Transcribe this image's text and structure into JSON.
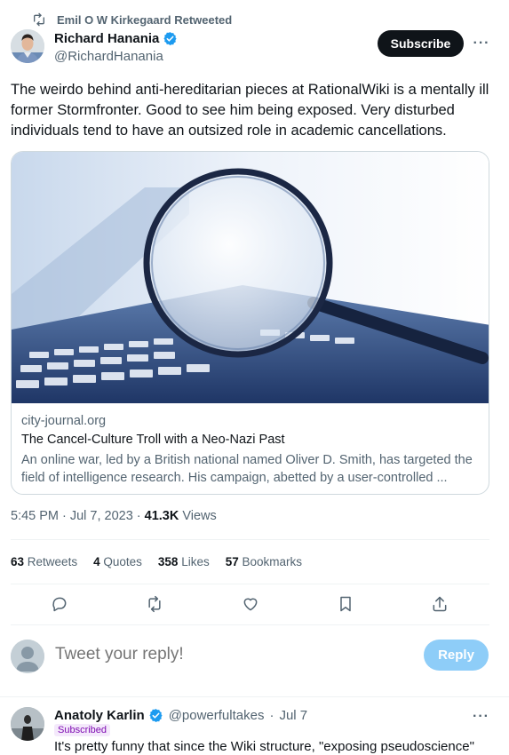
{
  "retweet_banner": {
    "icon": "retweet-icon",
    "text": "Emil O W Kirkegaard Retweeted"
  },
  "tweet": {
    "author_name": "Richard Hanania",
    "author_handle": "@RichardHanania",
    "verified_icon": "verified-badge-icon",
    "subscribe_label": "Subscribe",
    "more_label": "···",
    "text": "The weirdo behind anti-hereditarian pieces at RationalWiki is a mentally ill former Stormfronter. Good to see him being exposed. Very disturbed individuals tend to have an outsized role in academic cancellations.",
    "card": {
      "image": "magnifying-glass-on-keyboard",
      "domain": "city-journal.org",
      "title": "The Cancel-Culture Troll with a Neo-Nazi Past",
      "description": "An online war, led by a British national named Oliver D. Smith, has targeted the field of intelligence research. His campaign, abetted by a user-controlled ..."
    },
    "time": "5:45 PM",
    "date": "Jul 7, 2023",
    "views_count": "41.3K",
    "views_label": "Views",
    "stats": [
      {
        "count": "63",
        "label": "Retweets"
      },
      {
        "count": "4",
        "label": "Quotes"
      },
      {
        "count": "358",
        "label": "Likes"
      },
      {
        "count": "57",
        "label": "Bookmarks"
      }
    ],
    "actions": [
      "reply-icon",
      "retweet-icon",
      "like-icon",
      "bookmark-icon",
      "share-icon"
    ]
  },
  "reply_box": {
    "placeholder": "Tweet your reply!",
    "button_label": "Reply"
  },
  "reply": {
    "author_name": "Anatoly Karlin",
    "author_handle": "@powerfultakes",
    "date": "Jul 7",
    "badge": "Subscribed",
    "text": "It's pretty funny that since the Wiki structure, \"exposing pseudoscience\"",
    "more_label": "···"
  },
  "colors": {
    "primary_text": "#0f1419",
    "secondary_text": "#536471",
    "reply_button_disabled": "#8ecdf8",
    "verified_blue": "#1d9bf0",
    "divider": "#eff3f4"
  }
}
